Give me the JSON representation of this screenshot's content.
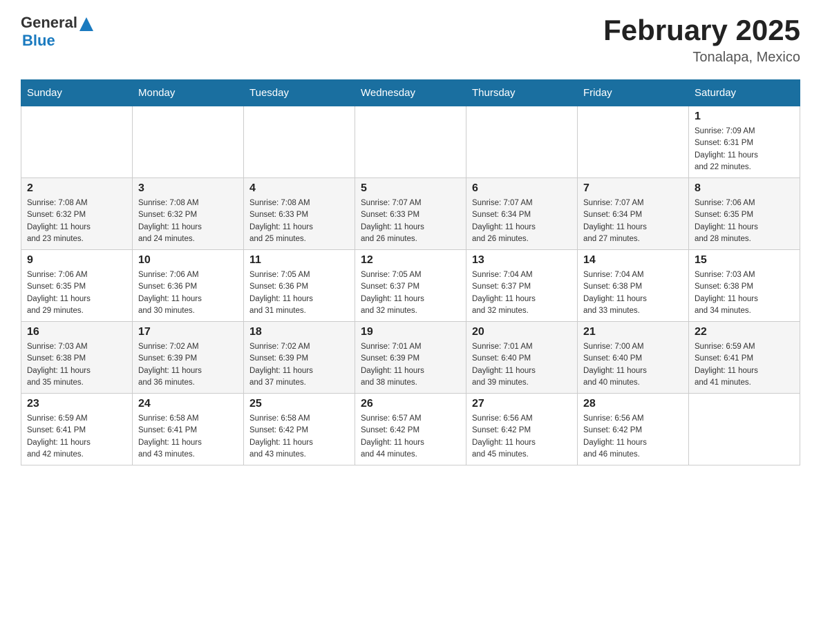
{
  "header": {
    "logo_general": "General",
    "logo_blue": "Blue",
    "month_year": "February 2025",
    "location": "Tonalapa, Mexico"
  },
  "days_of_week": [
    "Sunday",
    "Monday",
    "Tuesday",
    "Wednesday",
    "Thursday",
    "Friday",
    "Saturday"
  ],
  "weeks": [
    [
      {
        "day": "",
        "info": ""
      },
      {
        "day": "",
        "info": ""
      },
      {
        "day": "",
        "info": ""
      },
      {
        "day": "",
        "info": ""
      },
      {
        "day": "",
        "info": ""
      },
      {
        "day": "",
        "info": ""
      },
      {
        "day": "1",
        "info": "Sunrise: 7:09 AM\nSunset: 6:31 PM\nDaylight: 11 hours\nand 22 minutes."
      }
    ],
    [
      {
        "day": "2",
        "info": "Sunrise: 7:08 AM\nSunset: 6:32 PM\nDaylight: 11 hours\nand 23 minutes."
      },
      {
        "day": "3",
        "info": "Sunrise: 7:08 AM\nSunset: 6:32 PM\nDaylight: 11 hours\nand 24 minutes."
      },
      {
        "day": "4",
        "info": "Sunrise: 7:08 AM\nSunset: 6:33 PM\nDaylight: 11 hours\nand 25 minutes."
      },
      {
        "day": "5",
        "info": "Sunrise: 7:07 AM\nSunset: 6:33 PM\nDaylight: 11 hours\nand 26 minutes."
      },
      {
        "day": "6",
        "info": "Sunrise: 7:07 AM\nSunset: 6:34 PM\nDaylight: 11 hours\nand 26 minutes."
      },
      {
        "day": "7",
        "info": "Sunrise: 7:07 AM\nSunset: 6:34 PM\nDaylight: 11 hours\nand 27 minutes."
      },
      {
        "day": "8",
        "info": "Sunrise: 7:06 AM\nSunset: 6:35 PM\nDaylight: 11 hours\nand 28 minutes."
      }
    ],
    [
      {
        "day": "9",
        "info": "Sunrise: 7:06 AM\nSunset: 6:35 PM\nDaylight: 11 hours\nand 29 minutes."
      },
      {
        "day": "10",
        "info": "Sunrise: 7:06 AM\nSunset: 6:36 PM\nDaylight: 11 hours\nand 30 minutes."
      },
      {
        "day": "11",
        "info": "Sunrise: 7:05 AM\nSunset: 6:36 PM\nDaylight: 11 hours\nand 31 minutes."
      },
      {
        "day": "12",
        "info": "Sunrise: 7:05 AM\nSunset: 6:37 PM\nDaylight: 11 hours\nand 32 minutes."
      },
      {
        "day": "13",
        "info": "Sunrise: 7:04 AM\nSunset: 6:37 PM\nDaylight: 11 hours\nand 32 minutes."
      },
      {
        "day": "14",
        "info": "Sunrise: 7:04 AM\nSunset: 6:38 PM\nDaylight: 11 hours\nand 33 minutes."
      },
      {
        "day": "15",
        "info": "Sunrise: 7:03 AM\nSunset: 6:38 PM\nDaylight: 11 hours\nand 34 minutes."
      }
    ],
    [
      {
        "day": "16",
        "info": "Sunrise: 7:03 AM\nSunset: 6:38 PM\nDaylight: 11 hours\nand 35 minutes."
      },
      {
        "day": "17",
        "info": "Sunrise: 7:02 AM\nSunset: 6:39 PM\nDaylight: 11 hours\nand 36 minutes."
      },
      {
        "day": "18",
        "info": "Sunrise: 7:02 AM\nSunset: 6:39 PM\nDaylight: 11 hours\nand 37 minutes."
      },
      {
        "day": "19",
        "info": "Sunrise: 7:01 AM\nSunset: 6:39 PM\nDaylight: 11 hours\nand 38 minutes."
      },
      {
        "day": "20",
        "info": "Sunrise: 7:01 AM\nSunset: 6:40 PM\nDaylight: 11 hours\nand 39 minutes."
      },
      {
        "day": "21",
        "info": "Sunrise: 7:00 AM\nSunset: 6:40 PM\nDaylight: 11 hours\nand 40 minutes."
      },
      {
        "day": "22",
        "info": "Sunrise: 6:59 AM\nSunset: 6:41 PM\nDaylight: 11 hours\nand 41 minutes."
      }
    ],
    [
      {
        "day": "23",
        "info": "Sunrise: 6:59 AM\nSunset: 6:41 PM\nDaylight: 11 hours\nand 42 minutes."
      },
      {
        "day": "24",
        "info": "Sunrise: 6:58 AM\nSunset: 6:41 PM\nDaylight: 11 hours\nand 43 minutes."
      },
      {
        "day": "25",
        "info": "Sunrise: 6:58 AM\nSunset: 6:42 PM\nDaylight: 11 hours\nand 43 minutes."
      },
      {
        "day": "26",
        "info": "Sunrise: 6:57 AM\nSunset: 6:42 PM\nDaylight: 11 hours\nand 44 minutes."
      },
      {
        "day": "27",
        "info": "Sunrise: 6:56 AM\nSunset: 6:42 PM\nDaylight: 11 hours\nand 45 minutes."
      },
      {
        "day": "28",
        "info": "Sunrise: 6:56 AM\nSunset: 6:42 PM\nDaylight: 11 hours\nand 46 minutes."
      },
      {
        "day": "",
        "info": ""
      }
    ]
  ]
}
